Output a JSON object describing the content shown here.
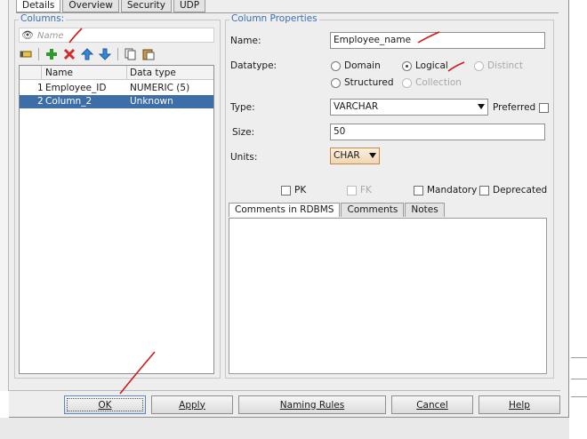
{
  "tabs": [
    "Details",
    "Overview",
    "Security",
    "UDP"
  ],
  "columns_group": {
    "title": "Columns:",
    "search_placeholder": "Name",
    "table_headers": [
      "Name",
      "Data type"
    ],
    "rows": [
      {
        "num": "1",
        "name": "Employee_ID",
        "dtype": "NUMERIC (5)",
        "selected": false
      },
      {
        "num": "2",
        "name": "Column_2",
        "dtype": "Unknown",
        "selected": true
      }
    ]
  },
  "props": {
    "title": "Column Properties",
    "name_label": "Name:",
    "name_value": "Employee_name",
    "datatype_label": "Datatype:",
    "radio_domain": "Domain",
    "radio_logical": "Logical",
    "radio_distinct": "Distinct",
    "radio_structured": "Structured",
    "radio_collection": "Collection",
    "type_label": "Type:",
    "type_value": "VARCHAR",
    "preferred_label": "Preferred",
    "size_label": "Size:",
    "size_value": "50",
    "units_label": "Units:",
    "units_value": "CHAR",
    "pk_label": "PK",
    "fk_label": "FK",
    "mandatory_label": "Mandatory",
    "deprecated_label": "Deprecated",
    "sub_tabs": [
      "Comments in RDBMS",
      "Comments",
      "Notes"
    ]
  },
  "buttons": {
    "ok": "OK",
    "apply": "Apply",
    "naming_rules": "Naming Rules",
    "cancel": "Cancel",
    "help": "Help"
  },
  "colors": {
    "selection": "#3d6ea8",
    "group_title": "#3a6fb0",
    "annotation": "#d11a1a"
  },
  "icons": {
    "search": "binoculars-icon",
    "toolbar": [
      "edit-icon",
      "add-icon",
      "delete-icon",
      "move-up-icon",
      "move-down-icon",
      "copy-icon",
      "paste-icon"
    ]
  }
}
